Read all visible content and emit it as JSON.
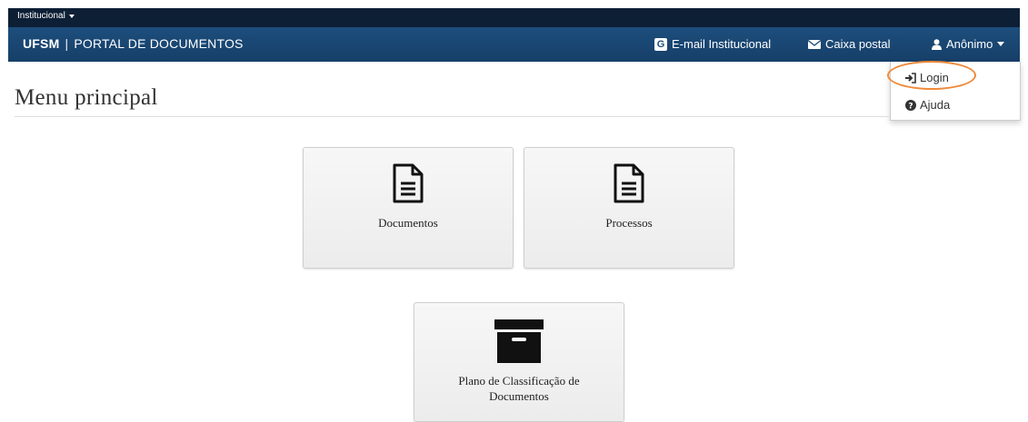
{
  "topbar": {
    "institutional_label": "Institucional"
  },
  "navbar": {
    "brand_strong": "UFSM",
    "brand_separator": "|",
    "brand_text": "PORTAL DE DOCUMENTOS",
    "email_label": "E-mail Institucional",
    "email_icon_letter": "G",
    "mailbox_label": "Caixa postal",
    "user_label": "Anônimo"
  },
  "user_menu": {
    "items": [
      {
        "label": "Login",
        "icon": "sign-in-icon"
      },
      {
        "label": "Ajuda",
        "icon": "question-circle-icon"
      }
    ],
    "highlight_color": "#f08a3a"
  },
  "main": {
    "title": "Menu principal",
    "tiles": [
      {
        "label": "Documentos",
        "icon": "document-icon"
      },
      {
        "label": "Processos",
        "icon": "document-icon"
      },
      {
        "label": "Plano de Classificação de Documentos",
        "icon": "archive-box-icon"
      }
    ]
  },
  "colors": {
    "topbar_bg": "#0d1f35",
    "navbar_bg": "#1d4e7d",
    "tile_bg": "#f2f2f2"
  }
}
